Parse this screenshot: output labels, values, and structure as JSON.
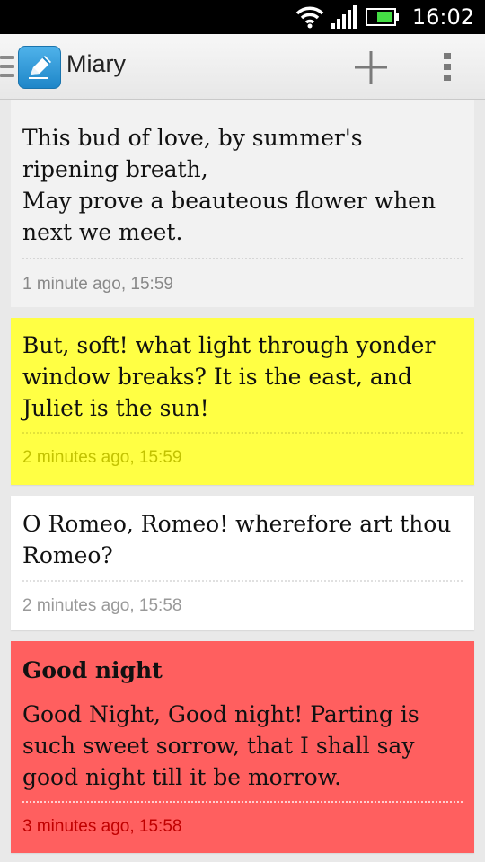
{
  "status_bar": {
    "time": "16:02",
    "icons": [
      "wifi-icon",
      "signal-icon",
      "battery-icon"
    ]
  },
  "action_bar": {
    "title": "Miary",
    "icons": [
      "drawer-icon",
      "app-logo-pencil-icon",
      "add-icon",
      "overflow-menu-icon"
    ]
  },
  "notes": [
    {
      "body": "This bud of love, by summer's ripening breath,\nMay prove a beauteous flower when next we meet.",
      "meta": "1 minute ago, 15:59",
      "color": "#f2f2f2"
    },
    {
      "body": "But, soft! what light through yonder window breaks? It is the east, and Juliet is the sun!",
      "meta": "2 minutes ago, 15:59",
      "color": "#ffff44"
    },
    {
      "body": "O Romeo, Romeo! wherefore art thou Romeo?",
      "meta": "2 minutes ago, 15:58",
      "color": "#ffffff"
    },
    {
      "title": "Good night",
      "body": "Good Night, Good night! Parting is such sweet sorrow, that I shall say good night till it be morrow.",
      "meta": "3 minutes ago, 15:58",
      "color": "#ff5f5f"
    }
  ]
}
